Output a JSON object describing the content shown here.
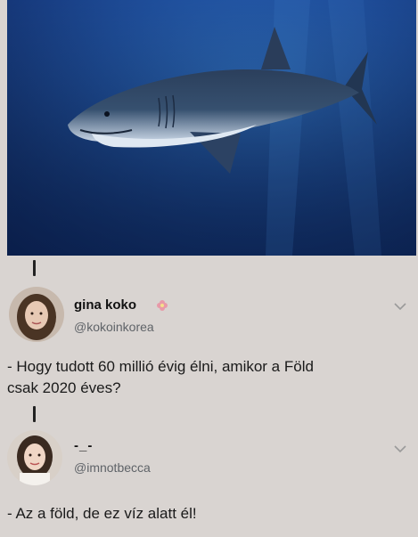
{
  "post1": {
    "display_name": "gina koko",
    "handle": "@kokoinkorea",
    "text_line1": "- Hogy tudott 60 millió évig élni, amikor a Föld",
    "text_line2": "csak 2020 éves?"
  },
  "post2": {
    "display_name": "-_-",
    "handle": "@imnotbecca",
    "text": "- Az a föld, de ez víz alatt él!"
  },
  "icons": {
    "badge": "flower-badge-icon",
    "menu": "chevron-down-icon"
  },
  "colors": {
    "water": "#1f4f9c",
    "card_bg": "#d9d4d1",
    "handle": "#5f6368"
  }
}
